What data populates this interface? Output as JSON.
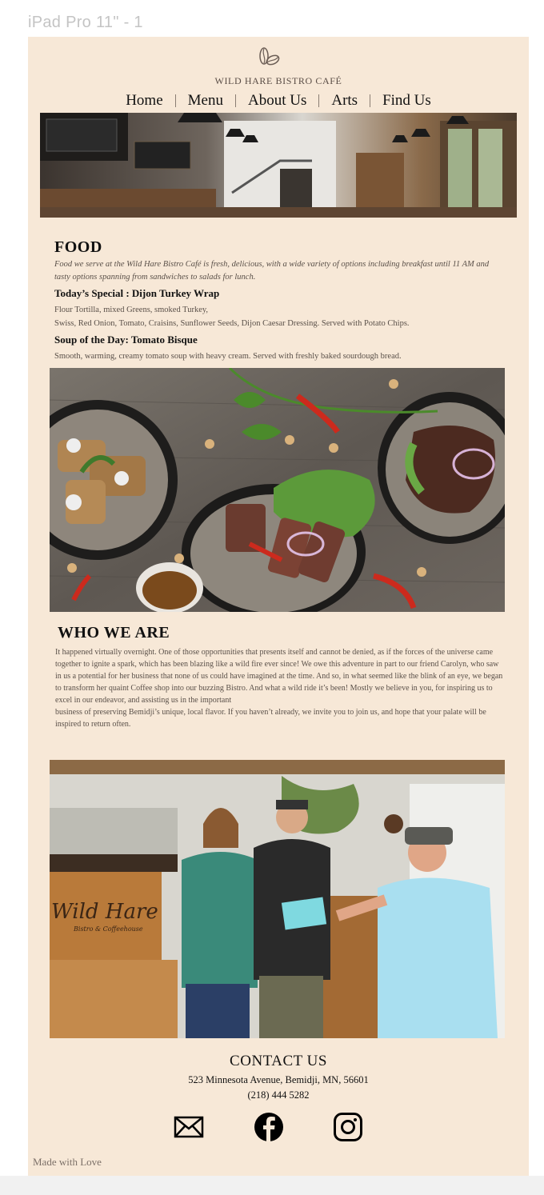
{
  "frame": {
    "label": "iPad Pro 11\" - 1"
  },
  "header": {
    "brand": "WILD HARE BISTRO CAFÉ",
    "nav": [
      "Home",
      "Menu",
      "About Us",
      "Arts",
      "Find Us"
    ]
  },
  "food": {
    "title": "FOOD",
    "intro": "Food we serve at the Wild Hare Bistro Café is fresh, delicious, with a wide variety of options including breakfast until 11 AM and tasty options spanning from sandwiches to salads for lunch.",
    "special_title": "Today’s Special : Dijon Turkey Wrap",
    "special_line1": "Flour Tortilla, mixed Greens, smoked Turkey,",
    "special_line2": "Swiss, Red Onion, Tomato, Craisins, Sunflower Seeds, Dijon Caesar Dressing. Served with Potato Chips.",
    "soup_title": "Soup of the Day: Tomato Bisque",
    "soup_desc": "Smooth, warming, creamy tomato soup with heavy cream. Served with freshly baked sourdough bread."
  },
  "who": {
    "title": "WHO WE ARE",
    "para1": "It happened virtually overnight. One of those opportunities that presents itself and cannot be denied, as if the forces of the universe came together to ignite a spark, which has been blazing like a wild fire ever since! We owe this adventure in part to our friend Carolyn, who saw in us a potential for her business that none of us could have imagined at the time. And so, in what seemed like the blink of an eye, we began to transform her quaint Coffee shop into our buzzing Bistro. And what a wild ride it’s been! Mostly we believe in you, for inspiring us to excel in our endeavor, and assisting us in the important",
    "para2": "business of preserving Bemidji’s unique, local flavor. If you haven’t already, we invite you to join us, and hope that your palate will be inspired to return often.",
    "sign_text": "Wild Hare",
    "sign_sub": "Bistro & Coffeehouse"
  },
  "contact": {
    "title": "CONTACT US",
    "address": "523 Minnesota Avenue, Bemidji, MN, 56601",
    "phone": "(218) 444 5282",
    "icons": [
      "mail-icon",
      "facebook-icon",
      "instagram-icon"
    ]
  },
  "footer": {
    "text": "Made with Love"
  }
}
